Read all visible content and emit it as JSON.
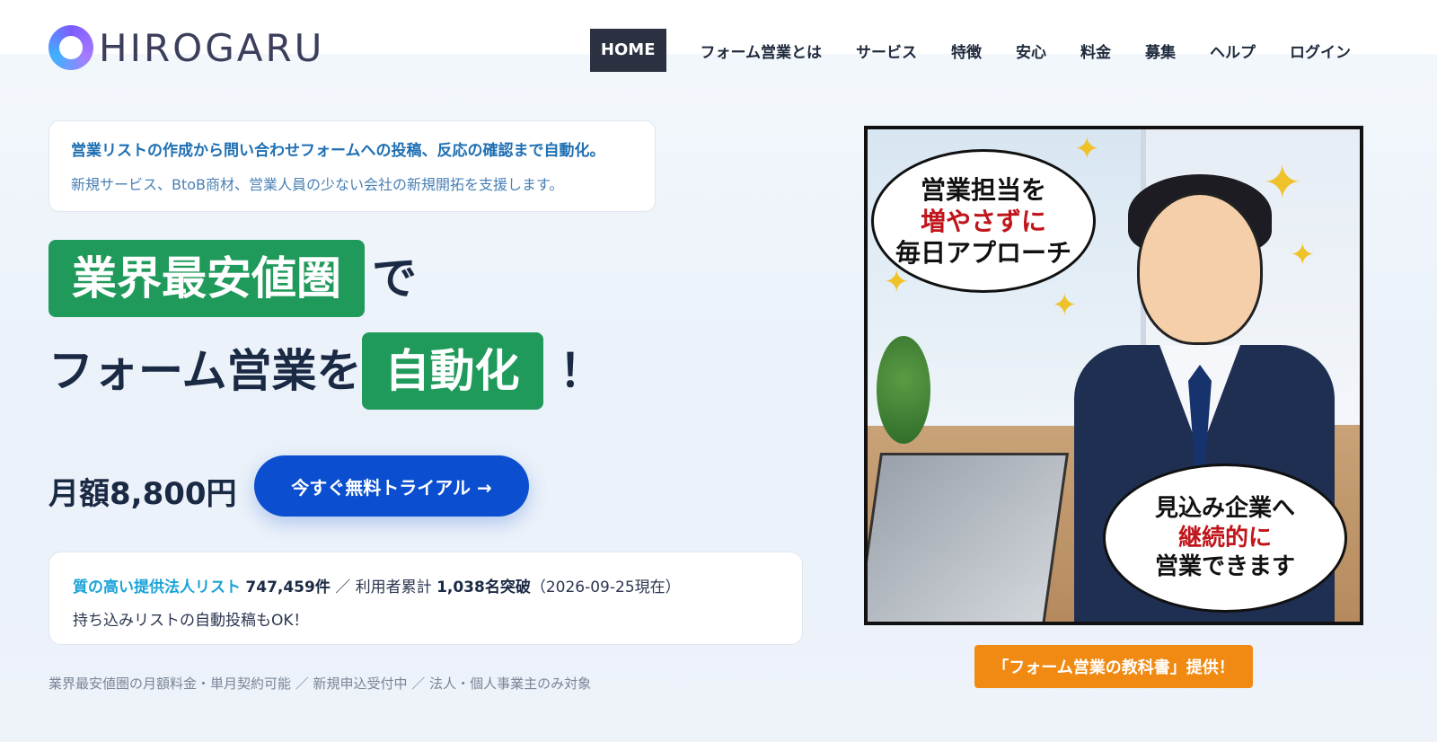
{
  "header": {
    "logo_text": "HIROGARU",
    "nav": [
      {
        "label": "HOME"
      },
      {
        "label": "フォーム営業とは"
      },
      {
        "label": "サービス"
      },
      {
        "label": "特徴"
      },
      {
        "label": "安心"
      },
      {
        "label": "料金"
      },
      {
        "label": "募集"
      },
      {
        "label": "ヘルプ"
      },
      {
        "label": "ログイン"
      }
    ]
  },
  "intro": {
    "line1": "営業リストの作成から問い合わせフォームへの投稿、反応の確認まで自動化。",
    "line2": "新規サービス、BtoB商材、営業人員の少ない会社の新規開拓を支援します。"
  },
  "headline": {
    "box1": "業界最安値圏",
    "text1": "で",
    "text2": "フォーム営業を",
    "box2": "自動化",
    "excl": "！"
  },
  "price": "月額8,800円",
  "cta_label": "今すぐ無料トライアル →",
  "stats": {
    "label": "質の高い提供法人リスト",
    "list_count": "747,459件",
    "sep": "／",
    "users_label": "利用者累計",
    "users_count": "1,038名突破",
    "date": "（2026-09-25現在）",
    "line2": "持ち込みリストの自動投稿もOK！"
  },
  "footnote": "業界最安値圏の月額料金・単月契約可能 ／ 新規申込受付中 ／ 法人・個人事業主のみ対象",
  "illustration": {
    "bubble1": [
      "営業担当を",
      "増やさずに",
      "毎日アプローチ"
    ],
    "bubble2": [
      "見込み企業へ",
      "継続的に",
      "営業できます"
    ]
  },
  "badge": "「フォーム営業の教科書」提供！",
  "colors": {
    "accent_green": "#1f9a5a",
    "cta_blue": "#0b4fd0",
    "badge_orange": "#f08a12",
    "nav_active": "#2b3140"
  }
}
